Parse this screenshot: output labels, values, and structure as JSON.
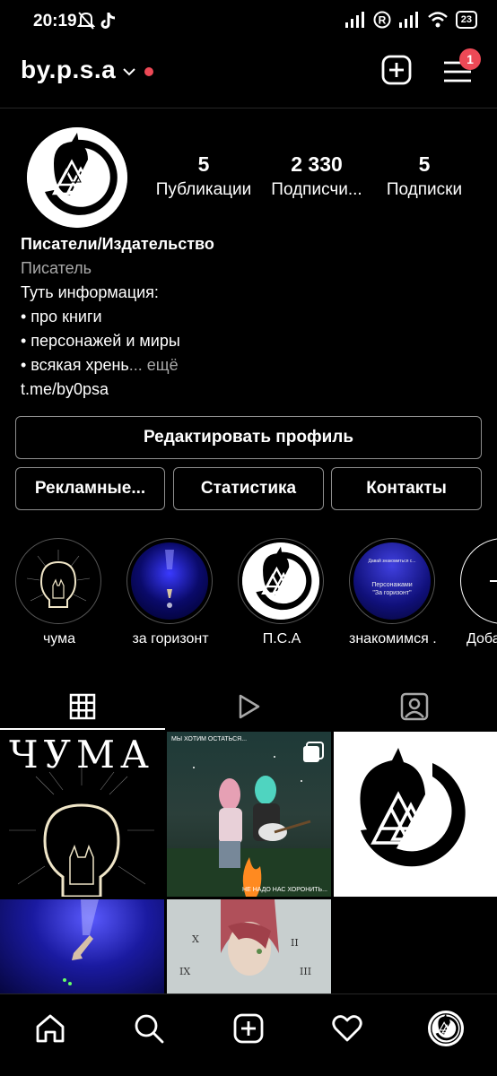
{
  "status_bar": {
    "time": "20:19",
    "battery": "23"
  },
  "header": {
    "username": "by.p.s.a",
    "notification_count": "1"
  },
  "profile": {
    "stats": [
      {
        "value": "5",
        "label": "Публикации"
      },
      {
        "value": "2 330",
        "label": "Подписчи..."
      },
      {
        "value": "5",
        "label": "Подписки"
      }
    ],
    "bio": {
      "name": "Писатели/Издательство",
      "category": "Писатель",
      "lines": [
        "Туть информация:",
        "• про книги",
        "• персонажей и миры",
        "• всякая хрень"
      ],
      "more": "... ещё",
      "link": "t.me/by0psa"
    }
  },
  "buttons": {
    "edit_profile": "Редактировать профиль",
    "ads": "Рекламные...",
    "stats": "Статистика",
    "contacts": "Контакты"
  },
  "highlights": [
    {
      "label": "чума"
    },
    {
      "label": "за горизонт"
    },
    {
      "label": "П.С.А"
    },
    {
      "label": "знакомимся ..."
    },
    {
      "label": "Доба"
    }
  ],
  "highlight_texts": {
    "znakom_top": "Давай знакомиться с...",
    "znakom_mid": "Персонажами",
    "znakom_bot": "\"За горизонт\""
  },
  "posts": {
    "p1_title": "ЧУМА",
    "p2_top": "МЫ ХОТИМ ОСТАТЬСЯ...",
    "p2_bottom": "НЕ НАДО НАС ХОРОНИТЬ..."
  },
  "clock_numerals": {
    "ten": "X",
    "two": "II",
    "nine": "IX",
    "three": "III"
  },
  "icons": [
    "mute-icon",
    "tiktok-icon",
    "signal-icon",
    "wifi-icon",
    "add-post-icon",
    "menu-icon",
    "grid-icon",
    "reels-icon",
    "tagged-icon",
    "home-icon",
    "search-icon",
    "create-icon",
    "heart-icon"
  ],
  "colors": {
    "accent_red": "#ed4956",
    "border": "#8e8e8e",
    "muted": "#a8a8a8"
  }
}
